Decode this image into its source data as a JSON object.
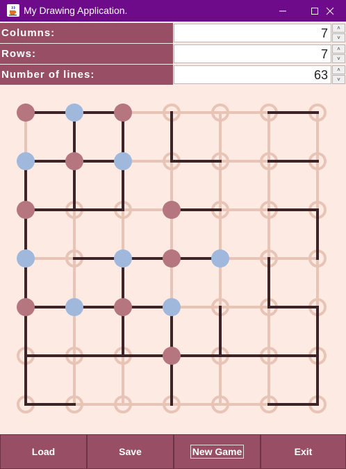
{
  "window": {
    "title": "My Drawing Application.",
    "app_icon": "java-cup-icon",
    "controls": {
      "minimize": "minimize-icon",
      "maximize": "maximize-icon",
      "close": "close-icon"
    }
  },
  "settings": {
    "columns": {
      "label": "Columns:",
      "value": "7"
    },
    "rows": {
      "label": "Rows:",
      "value": "7"
    },
    "lines": {
      "label": "Number of lines:",
      "value": "63"
    }
  },
  "board": {
    "grid_cols": 7,
    "grid_rows": 7,
    "colors": {
      "background": "#fdebe3",
      "grid": "#e8c4b6",
      "line": "#3d2428",
      "player_a": "#b5767f",
      "player_b": "#9fb8dc",
      "empty_ring": "#e8c4b6"
    },
    "lines": [
      [
        [
          0,
          0
        ],
        [
          1,
          0
        ]
      ],
      [
        [
          1,
          0
        ],
        [
          2,
          0
        ]
      ],
      [
        [
          5,
          0
        ],
        [
          6,
          0
        ]
      ],
      [
        [
          0,
          1
        ],
        [
          1,
          1
        ]
      ],
      [
        [
          1,
          1
        ],
        [
          2,
          1
        ]
      ],
      [
        [
          3,
          1
        ],
        [
          4,
          1
        ]
      ],
      [
        [
          5,
          1
        ],
        [
          6,
          1
        ]
      ],
      [
        [
          0,
          2
        ],
        [
          1,
          2
        ]
      ],
      [
        [
          1,
          2
        ],
        [
          2,
          2
        ]
      ],
      [
        [
          3,
          2
        ],
        [
          4,
          2
        ]
      ],
      [
        [
          5,
          2
        ],
        [
          6,
          2
        ]
      ],
      [
        [
          1,
          3
        ],
        [
          2,
          3
        ]
      ],
      [
        [
          2,
          3
        ],
        [
          3,
          3
        ]
      ],
      [
        [
          3,
          3
        ],
        [
          4,
          3
        ]
      ],
      [
        [
          0,
          4
        ],
        [
          1,
          4
        ]
      ],
      [
        [
          1,
          4
        ],
        [
          2,
          4
        ]
      ],
      [
        [
          2,
          4
        ],
        [
          3,
          4
        ]
      ],
      [
        [
          5,
          4
        ],
        [
          6,
          4
        ]
      ],
      [
        [
          0,
          5
        ],
        [
          1,
          5
        ]
      ],
      [
        [
          1,
          5
        ],
        [
          2,
          5
        ]
      ],
      [
        [
          2,
          5
        ],
        [
          3,
          5
        ]
      ],
      [
        [
          3,
          5
        ],
        [
          4,
          5
        ]
      ],
      [
        [
          4,
          5
        ],
        [
          5,
          5
        ]
      ],
      [
        [
          5,
          5
        ],
        [
          6,
          5
        ]
      ],
      [
        [
          0,
          6
        ],
        [
          1,
          6
        ]
      ],
      [
        [
          5,
          6
        ],
        [
          6,
          6
        ]
      ],
      [
        [
          1,
          0
        ],
        [
          1,
          1
        ]
      ],
      [
        [
          2,
          0
        ],
        [
          2,
          1
        ]
      ],
      [
        [
          3,
          0
        ],
        [
          3,
          1
        ]
      ],
      [
        [
          0,
          1
        ],
        [
          0,
          2
        ]
      ],
      [
        [
          1,
          1
        ],
        [
          1,
          2
        ]
      ],
      [
        [
          2,
          1
        ],
        [
          2,
          2
        ]
      ],
      [
        [
          6,
          2
        ],
        [
          6,
          3
        ]
      ],
      [
        [
          0,
          2
        ],
        [
          0,
          3
        ]
      ],
      [
        [
          2,
          3
        ],
        [
          2,
          4
        ]
      ],
      [
        [
          5,
          3
        ],
        [
          5,
          4
        ]
      ],
      [
        [
          0,
          3
        ],
        [
          0,
          4
        ]
      ],
      [
        [
          2,
          4
        ],
        [
          2,
          5
        ]
      ],
      [
        [
          3,
          4
        ],
        [
          3,
          5
        ]
      ],
      [
        [
          4,
          4
        ],
        [
          4,
          5
        ]
      ],
      [
        [
          6,
          4
        ],
        [
          6,
          5
        ]
      ],
      [
        [
          0,
          4
        ],
        [
          0,
          5
        ]
      ],
      [
        [
          3,
          5
        ],
        [
          3,
          6
        ]
      ],
      [
        [
          6,
          5
        ],
        [
          6,
          6
        ]
      ],
      [
        [
          0,
          5
        ],
        [
          0,
          6
        ]
      ]
    ],
    "boxes": [
      {
        "col": 0,
        "row": 0,
        "owner": "a"
      },
      {
        "col": 1,
        "row": 0,
        "owner": "b"
      },
      {
        "col": 2,
        "row": 0,
        "owner": "a"
      },
      {
        "col": 0,
        "row": 1,
        "owner": "b"
      },
      {
        "col": 1,
        "row": 1,
        "owner": "a"
      },
      {
        "col": 2,
        "row": 1,
        "owner": "b"
      },
      {
        "col": 0,
        "row": 2,
        "owner": "a"
      },
      {
        "col": 3,
        "row": 2,
        "owner": "a"
      },
      {
        "col": 0,
        "row": 3,
        "owner": "b"
      },
      {
        "col": 2,
        "row": 3,
        "owner": "b"
      },
      {
        "col": 3,
        "row": 3,
        "owner": "a"
      },
      {
        "col": 4,
        "row": 3,
        "owner": "b"
      },
      {
        "col": 0,
        "row": 4,
        "owner": "a"
      },
      {
        "col": 1,
        "row": 4,
        "owner": "b"
      },
      {
        "col": 2,
        "row": 4,
        "owner": "a"
      },
      {
        "col": 3,
        "row": 4,
        "owner": "b"
      },
      {
        "col": 3,
        "row": 5,
        "owner": "a"
      }
    ]
  },
  "footer": {
    "load": "Load",
    "save": "Save",
    "new_game": "New Game",
    "exit": "Exit"
  }
}
